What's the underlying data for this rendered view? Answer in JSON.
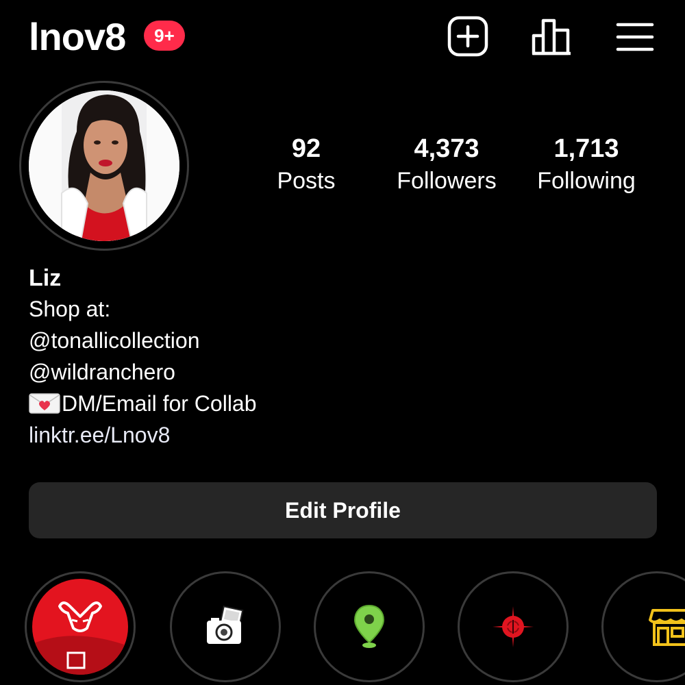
{
  "header": {
    "username": "lnov8",
    "notification_badge": "9+",
    "icons": [
      "new-post-icon",
      "insights-icon",
      "menu-icon"
    ]
  },
  "stats": [
    {
      "value": "92",
      "label": "Posts"
    },
    {
      "value": "4,373",
      "label": "Followers"
    },
    {
      "value": "1,713",
      "label": "Following"
    }
  ],
  "bio": {
    "name": "Liz",
    "lines": [
      "Shop at:",
      "@tonallicollection",
      "@wildranchero",
      "DM/Email for Collab"
    ],
    "link": "linktr.ee/Lnov8"
  },
  "edit_profile_label": "Edit Profile",
  "highlights": [
    {
      "icon": "bull-hat-image"
    },
    {
      "icon": "camera-icon"
    },
    {
      "icon": "location-pin-icon"
    },
    {
      "icon": "target-icon"
    },
    {
      "icon": "store-icon"
    }
  ],
  "colors": {
    "background": "#000000",
    "badge": "#ff2b4a",
    "button": "#262626",
    "ring": "#3a3a3a"
  }
}
